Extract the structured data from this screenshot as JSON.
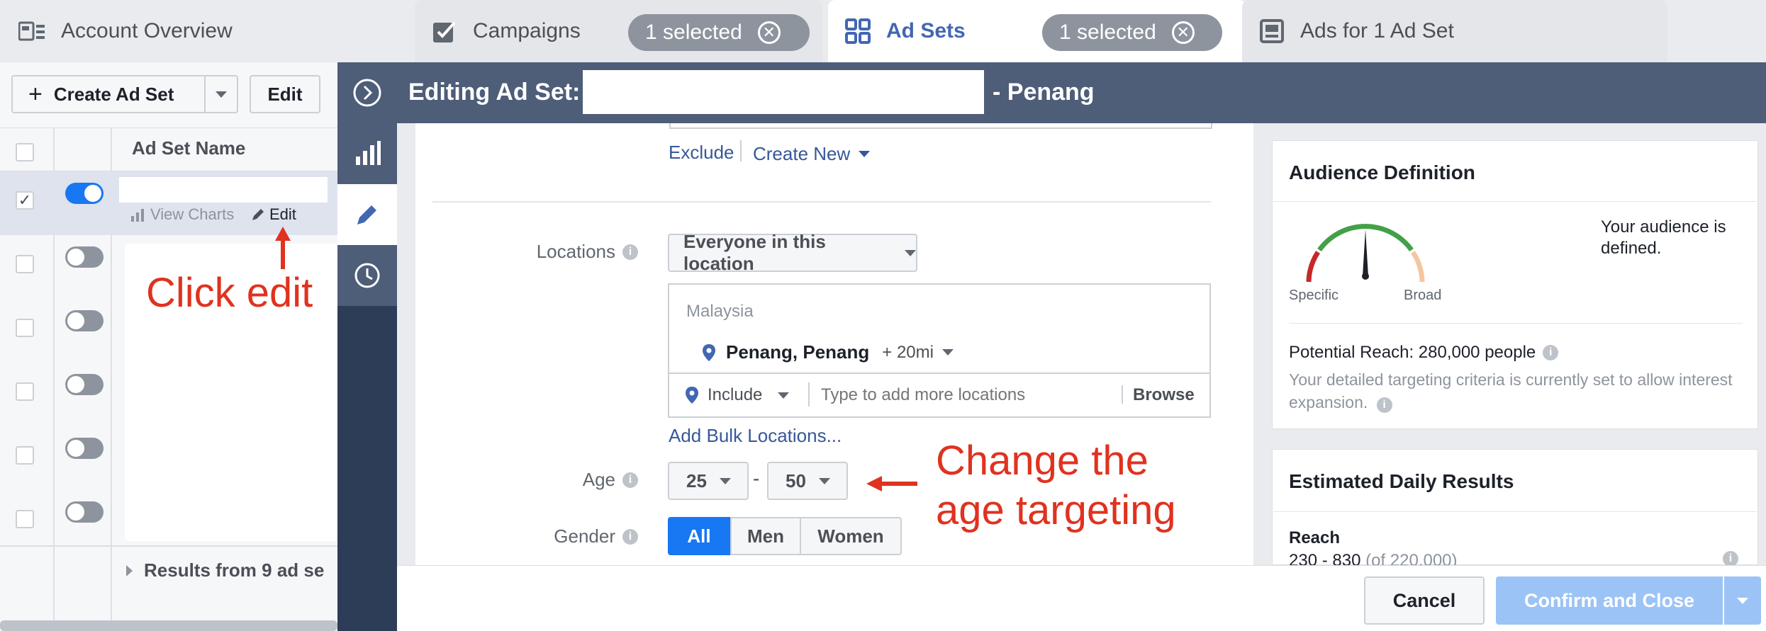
{
  "tabs": {
    "account": "Account Overview",
    "campaigns": "Campaigns",
    "campaigns_selected": "1 selected",
    "adsets": "Ad Sets",
    "adsets_selected": "1 selected",
    "ads": "Ads for 1 Ad Set"
  },
  "toolbar": {
    "create_label": "Create Ad Set",
    "edit_label": "Edit"
  },
  "table": {
    "column_name": "Ad Set Name",
    "row_actions": {
      "view_charts": "View Charts",
      "edit": "Edit"
    },
    "footer": "Results from 9 ad se"
  },
  "annotations": {
    "click_edit": "Click edit",
    "change_age_line1": "Change the",
    "change_age_line2": "age targeting"
  },
  "modal": {
    "title_prefix": "Editing Ad Set:",
    "title_suffix": "- Penang",
    "exclude": "Exclude",
    "create_new": "Create New",
    "locations_label": "Locations",
    "locations_mode": "Everyone in this location",
    "country": "Malaysia",
    "location_name": "Penang, Penang",
    "radius": "+ 20mi",
    "include_label": "Include",
    "location_placeholder": "Type to add more locations",
    "browse": "Browse",
    "bulk_locations": "Add Bulk Locations...",
    "age_label": "Age",
    "age_min": "25",
    "age_sep": "-",
    "age_max": "50",
    "gender_label": "Gender",
    "gender_options": {
      "all": "All",
      "men": "Men",
      "women": "Women"
    },
    "gender_selected": "All"
  },
  "audience": {
    "title": "Audience Definition",
    "status": "Your audience is defined.",
    "gauge_left": "Specific",
    "gauge_right": "Broad",
    "potential_reach": "Potential Reach: 280,000 people",
    "expansion_note": "Your detailed targeting criteria is currently set to allow interest expansion."
  },
  "estimated": {
    "title": "Estimated Daily Results",
    "reach_label": "Reach",
    "reach_value": "230 - 830",
    "reach_total": "(of 220,000)"
  },
  "footer": {
    "cancel": "Cancel",
    "confirm": "Confirm and Close"
  },
  "colors": {
    "header": "#4e5d78",
    "rail": "#2e3d57",
    "accent": "#1877f2",
    "annotation": "#e0321f",
    "confirm_disabled": "#9cc3f5"
  }
}
